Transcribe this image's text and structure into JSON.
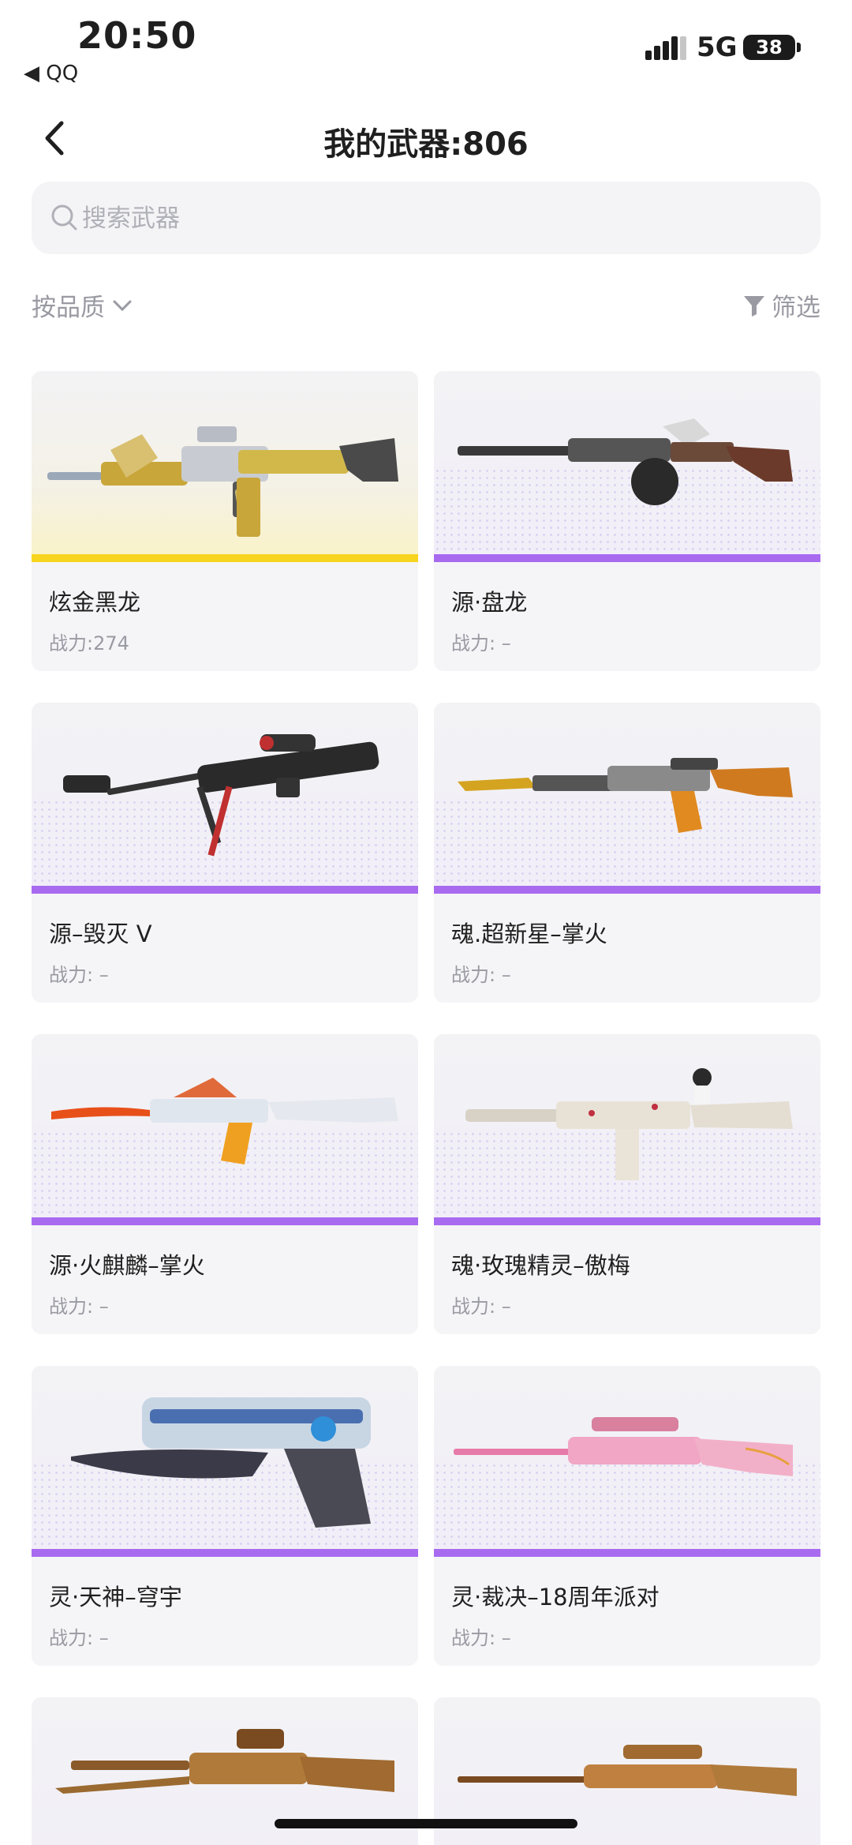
{
  "status_bar": {
    "time": "20:50",
    "back_app": "◀ QQ",
    "network": "5G",
    "battery": "38"
  },
  "nav": {
    "title": "我的武器:806"
  },
  "search": {
    "placeholder": "搜索武器"
  },
  "toolbar": {
    "sort_label": "按品质",
    "filter_label": "筛选"
  },
  "colors": {
    "gold_bar": "#f7d51e",
    "purple_bar": "#a86bf0"
  },
  "weapons": [
    {
      "name": "炫金黑龙",
      "power": "战力:274",
      "tier": "gold"
    },
    {
      "name": "源·盘龙",
      "power": "战力: –",
      "tier": "purple"
    },
    {
      "name": "源–毁灭 V",
      "power": "战力: –",
      "tier": "purple"
    },
    {
      "name": "魂.超新星–掌火",
      "power": "战力: –",
      "tier": "purple"
    },
    {
      "name": "源·火麒麟–掌火",
      "power": "战力: –",
      "tier": "purple"
    },
    {
      "name": "魂·玫瑰精灵–傲梅",
      "power": "战力: –",
      "tier": "purple"
    },
    {
      "name": "灵·天神–穹宇",
      "power": "战力: –",
      "tier": "purple"
    },
    {
      "name": "灵·裁决–18周年派对",
      "power": "战力: –",
      "tier": "purple"
    },
    {
      "name": "",
      "power": "",
      "tier": "purple"
    },
    {
      "name": "",
      "power": "",
      "tier": "purple"
    }
  ]
}
